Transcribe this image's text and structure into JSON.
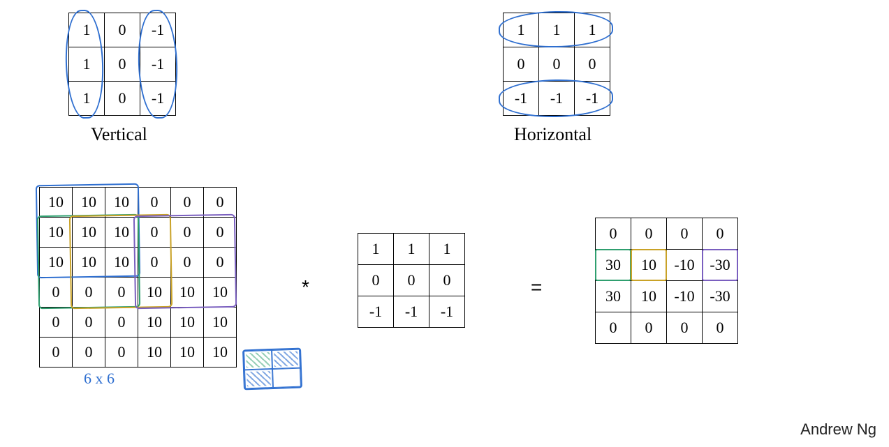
{
  "title_area": "",
  "filters": {
    "vertical": {
      "label": "Vertical",
      "grid": [
        [
          "1",
          "0",
          "-1"
        ],
        [
          "1",
          "0",
          "-1"
        ],
        [
          "1",
          "0",
          "-1"
        ]
      ]
    },
    "horizontal": {
      "label": "Horizontal",
      "grid": [
        [
          "1",
          "1",
          "1"
        ],
        [
          "0",
          "0",
          "0"
        ],
        [
          "-1",
          "-1",
          "-1"
        ]
      ]
    }
  },
  "example": {
    "input6x6": [
      [
        "10",
        "10",
        "10",
        "0",
        "0",
        "0"
      ],
      [
        "10",
        "10",
        "10",
        "0",
        "0",
        "0"
      ],
      [
        "10",
        "10",
        "10",
        "0",
        "0",
        "0"
      ],
      [
        "0",
        "0",
        "0",
        "10",
        "10",
        "10"
      ],
      [
        "0",
        "0",
        "0",
        "10",
        "10",
        "10"
      ],
      [
        "0",
        "0",
        "0",
        "10",
        "10",
        "10"
      ]
    ],
    "input_note": "6 x 6",
    "conv_op": "*",
    "filter": [
      [
        "1",
        "1",
        "1"
      ],
      [
        "0",
        "0",
        "0"
      ],
      [
        "-1",
        "-1",
        "-1"
      ]
    ],
    "equals": "=",
    "output4x4": [
      [
        "0",
        "0",
        "0",
        "0"
      ],
      [
        "30",
        "10",
        "-10",
        "-30"
      ],
      [
        "30",
        "10",
        "-10",
        "-30"
      ],
      [
        "0",
        "0",
        "0",
        "0"
      ]
    ]
  },
  "credit": "Andrew Ng",
  "chart_data": {
    "type": "diagram",
    "description": "Convolutional edge-detection filters (vertical and horizontal) and one worked 6×6 * 3×3 horizontal-filter convolution producing a 4×4 output.",
    "vertical_filter": [
      [
        1,
        0,
        -1
      ],
      [
        1,
        0,
        -1
      ],
      [
        1,
        0,
        -1
      ]
    ],
    "horizontal_filter": [
      [
        1,
        1,
        1
      ],
      [
        0,
        0,
        0
      ],
      [
        -1,
        -1,
        -1
      ]
    ],
    "input": [
      [
        10,
        10,
        10,
        0,
        0,
        0
      ],
      [
        10,
        10,
        10,
        0,
        0,
        0
      ],
      [
        10,
        10,
        10,
        0,
        0,
        0
      ],
      [
        0,
        0,
        0,
        10,
        10,
        10
      ],
      [
        0,
        0,
        0,
        10,
        10,
        10
      ],
      [
        0,
        0,
        0,
        10,
        10,
        10
      ]
    ],
    "filter_used": [
      [
        1,
        1,
        1
      ],
      [
        0,
        0,
        0
      ],
      [
        -1,
        -1,
        -1
      ]
    ],
    "output": [
      [
        0,
        0,
        0,
        0
      ],
      [
        30,
        10,
        -10,
        -30
      ],
      [
        30,
        10,
        -10,
        -30
      ],
      [
        0,
        0,
        0,
        0
      ]
    ],
    "annotations": [
      "6 x 6",
      "Vertical",
      "Horizontal",
      "Andrew Ng"
    ]
  }
}
